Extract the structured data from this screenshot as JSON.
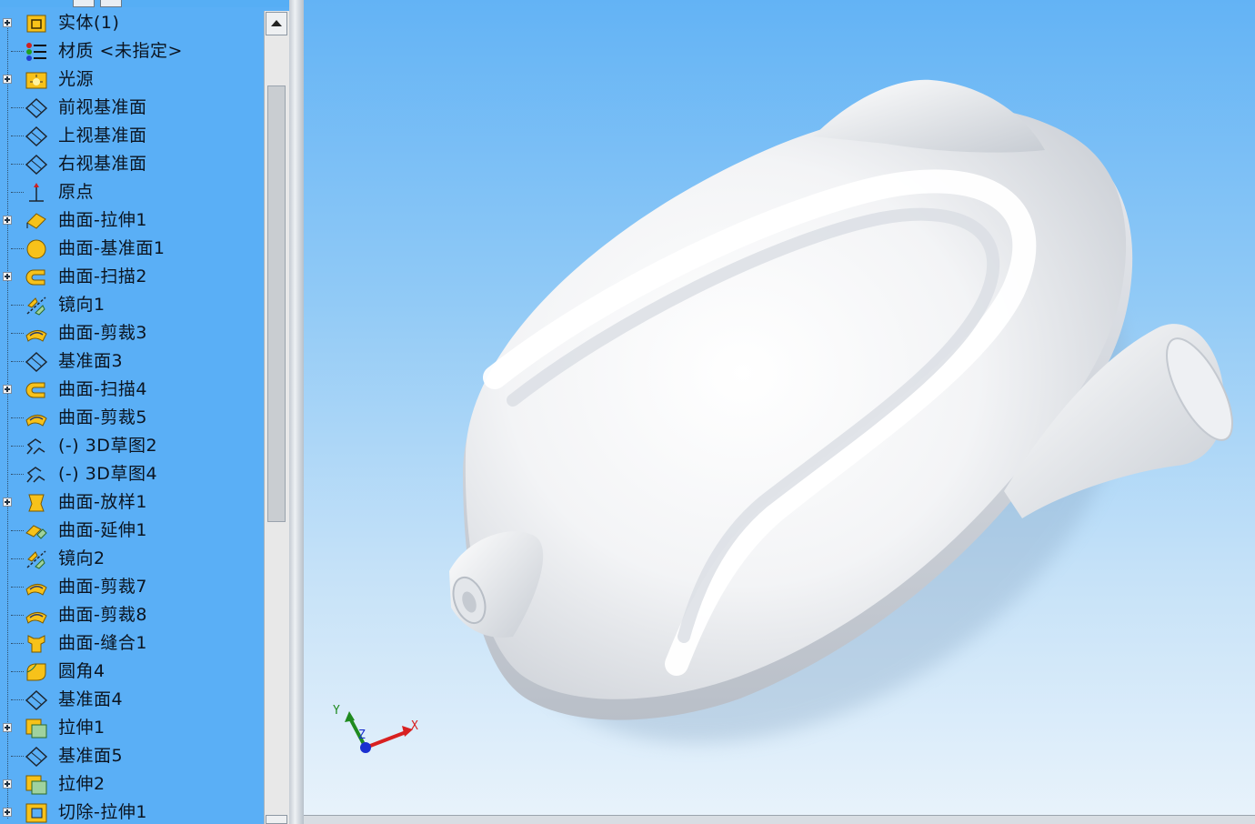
{
  "feature_tree": {
    "items": [
      {
        "label": "实体(1)",
        "icon": "solid-bodies-icon",
        "expandable": true
      },
      {
        "label": "材质 <未指定>",
        "icon": "material-icon",
        "expandable": false
      },
      {
        "label": "光源",
        "icon": "lights-icon",
        "expandable": true
      },
      {
        "label": "前视基准面",
        "icon": "plane-icon",
        "expandable": false
      },
      {
        "label": "上视基准面",
        "icon": "plane-icon",
        "expandable": false
      },
      {
        "label": "右视基准面",
        "icon": "plane-icon",
        "expandable": false
      },
      {
        "label": "原点",
        "icon": "origin-icon",
        "expandable": false
      },
      {
        "label": "曲面-拉伸1",
        "icon": "surface-extrude-icon",
        "expandable": true
      },
      {
        "label": "曲面-基准面1",
        "icon": "planar-surface-icon",
        "expandable": false
      },
      {
        "label": "曲面-扫描2",
        "icon": "surface-sweep-icon",
        "expandable": true
      },
      {
        "label": "镜向1",
        "icon": "mirror-icon",
        "expandable": false
      },
      {
        "label": "曲面-剪裁3",
        "icon": "surface-trim-icon",
        "expandable": false
      },
      {
        "label": "基准面3",
        "icon": "plane-icon",
        "expandable": false
      },
      {
        "label": "曲面-扫描4",
        "icon": "surface-sweep-icon",
        "expandable": true
      },
      {
        "label": "曲面-剪裁5",
        "icon": "surface-trim-icon",
        "expandable": false
      },
      {
        "label": "(-) 3D草图2",
        "icon": "3d-sketch-icon",
        "expandable": false
      },
      {
        "label": "(-) 3D草图4",
        "icon": "3d-sketch-icon",
        "expandable": false
      },
      {
        "label": "曲面-放样1",
        "icon": "surface-loft-icon",
        "expandable": true
      },
      {
        "label": "曲面-延伸1",
        "icon": "surface-extend-icon",
        "expandable": false
      },
      {
        "label": "镜向2",
        "icon": "mirror-icon",
        "expandable": false
      },
      {
        "label": "曲面-剪裁7",
        "icon": "surface-trim-icon",
        "expandable": false
      },
      {
        "label": "曲面-剪裁8",
        "icon": "surface-trim-icon",
        "expandable": false
      },
      {
        "label": "曲面-缝合1",
        "icon": "surface-knit-icon",
        "expandable": false
      },
      {
        "label": "圆角4",
        "icon": "fillet-icon",
        "expandable": false
      },
      {
        "label": "基准面4",
        "icon": "plane-icon",
        "expandable": false
      },
      {
        "label": "拉伸1",
        "icon": "boss-extrude-icon",
        "expandable": true
      },
      {
        "label": "基准面5",
        "icon": "plane-icon",
        "expandable": false
      },
      {
        "label": "拉伸2",
        "icon": "boss-extrude-icon",
        "expandable": true
      },
      {
        "label": "切除-拉伸1",
        "icon": "cut-extrude-icon",
        "expandable": true
      }
    ]
  },
  "triad": {
    "x": "X",
    "y": "Y",
    "z": "Z"
  },
  "colors": {
    "panel_bg": "#5aaff6",
    "icon_yellow": "#f7c21a",
    "axis_x": "#d82020",
    "axis_y": "#1f8a1f",
    "axis_z": "#1a2fd0"
  }
}
